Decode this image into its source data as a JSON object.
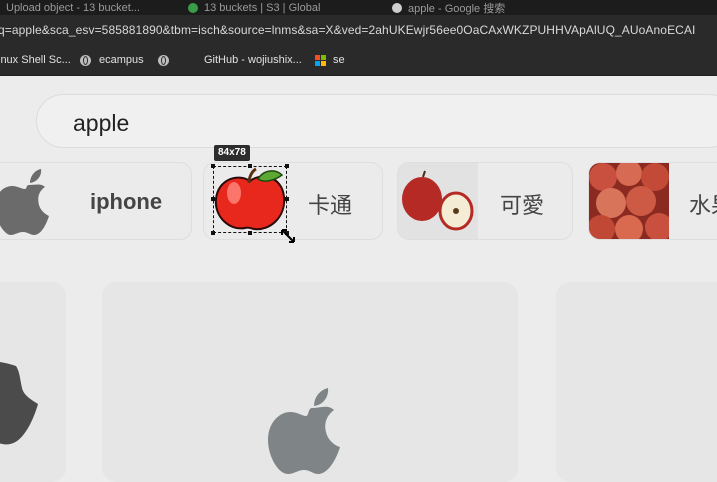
{
  "browser": {
    "tabs": [
      {
        "label": "Upload object - 13 bucket..."
      },
      {
        "label": "13 buckets | S3 | Global"
      },
      {
        "label": "apple - Google 搜索"
      }
    ],
    "url": "q=apple&sca_esv=585881890&tbm=isch&source=lnms&sa=X&ved=2ahUKEwjr56ee0OaCAxWKZPUHHVApAlUQ_AUoAnoECAI",
    "bookmarks": [
      {
        "label": "inux Shell Sc..."
      },
      {
        "label": "ecampus"
      },
      {
        "label": ""
      },
      {
        "label": "GitHub - wojiushix..."
      },
      {
        "label": "se"
      }
    ]
  },
  "search": {
    "value": "apple"
  },
  "chips": [
    {
      "label": "iphone"
    },
    {
      "label": "卡通"
    },
    {
      "label": "可愛"
    },
    {
      "label": "水果"
    }
  ],
  "selection": {
    "size_label": "84x78"
  },
  "colors": {
    "accent_red": "#e8271d",
    "ms_red": "#f25022",
    "ms_green": "#7fba00",
    "ms_blue": "#00a4ef",
    "ms_yellow": "#ffb900"
  }
}
